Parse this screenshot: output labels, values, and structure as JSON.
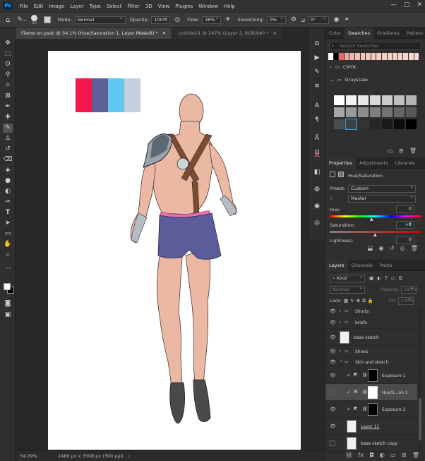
{
  "menubar": {
    "logo": "Ps",
    "items": [
      "File",
      "Edit",
      "Image",
      "Layer",
      "Type",
      "Select",
      "Filter",
      "3D",
      "View",
      "Plugins",
      "Window",
      "Help"
    ],
    "window_buttons": [
      "—",
      "▢",
      "✕"
    ]
  },
  "options": {
    "brush_size": "20",
    "mode_label": "Mode:",
    "mode_value": "Normal",
    "opacity_label": "Opacity:",
    "opacity_value": "100%",
    "flow_label": "Flow:",
    "flow_value": "38%",
    "smoothing_label": "Smoothing:",
    "smoothing_value": "0%",
    "angle_value": "0°"
  },
  "tabs": [
    {
      "label": "Flame on.psdc @ 34.1% (Hue/Saturation 1, Layer Mask/8) *",
      "close": "✕"
    },
    {
      "label": "Untitled-1 @ 247% (Layer 2, RGB/8#) *",
      "close": "✕"
    }
  ],
  "status": {
    "zoom": "34.09%",
    "doc_info": "2480 px x 3508 px (300 ppi)",
    "arrow": "›"
  },
  "canvas_swatches": [
    "#f2174f",
    "#5e5f96",
    "#61c8f1",
    "#c4d0dc"
  ],
  "swatches_panel": {
    "tabs": [
      "Color",
      "Swatches",
      "Gradients",
      "Pattern"
    ],
    "search_placeholder": "Search Swatches",
    "groups": [
      "CMYK",
      "Grayscale"
    ],
    "recent_colors": [
      "#ffffff",
      "#000000",
      "#e46a6a",
      "#f0a39b",
      "#f0b5a8",
      "#f0bfb3",
      "#f1c6bb",
      "#f3c7bd",
      "#f4cabf",
      "#f5cdc2",
      "#f5cfc4",
      "#f6d0c6",
      "#f6d2c8",
      "#f7d4ca",
      "#f8d6cd",
      "#f8d8d0",
      "#f9dad2"
    ]
  },
  "properties_panel": {
    "tabs": [
      "Properties",
      "Adjustments",
      "Libraries"
    ],
    "type_label": "Hue/Saturation",
    "preset_label": "Preset:",
    "preset_value": "Custom",
    "channel_value": "Master",
    "hue_label": "Hue:",
    "hue_value": "0",
    "saturation_label": "Saturation:",
    "saturation_value": "+8",
    "lightness_label": "Lightness:",
    "lightness_value": "0"
  },
  "layers_panel": {
    "tabs": [
      "Layers",
      "Channels",
      "Paths"
    ],
    "filter_value": "Kind",
    "blend_value": "Normal",
    "opacity_label": "Opacity:",
    "opacity_value": "100%",
    "lock_label": "Lock:",
    "fill_label": "Fill:",
    "fill_value": "100%",
    "layers": [
      {
        "name": "Shorts",
        "kind": "group"
      },
      {
        "name": "briefs",
        "kind": "group"
      },
      {
        "name": "base sketch",
        "kind": "pixel"
      },
      {
        "name": "Shoes",
        "kind": "group"
      },
      {
        "name": "Skin and sketch",
        "kind": "group-open"
      },
      {
        "name": "Exposure 1",
        "kind": "adjust"
      },
      {
        "name": "Hue/S...on 1",
        "kind": "adjust-selected"
      },
      {
        "name": "Exposure 2",
        "kind": "adjust"
      },
      {
        "name": "Layer 11",
        "kind": "pixel"
      },
      {
        "name": "base sketch copy",
        "kind": "pixel"
      }
    ],
    "footer_icons": [
      "link-icon",
      "fx-icon",
      "mask-icon",
      "adjustment-icon",
      "folder-icon",
      "new-layer-icon",
      "trash-icon"
    ]
  }
}
